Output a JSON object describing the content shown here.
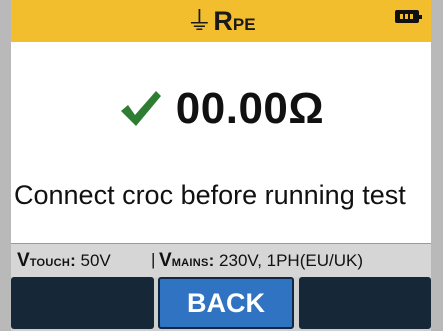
{
  "header": {
    "title_symbol": "⏚",
    "title_main": "R",
    "title_sub": "PE",
    "battery_icon": "battery-full-icon"
  },
  "result": {
    "status_icon": "check-icon",
    "value": "00.00Ω"
  },
  "message": "Connect croc before running test",
  "status_bar": {
    "vtouch_letter": "V",
    "vtouch_sub": "TOUCH",
    "vtouch_value": "50V",
    "separator": "|",
    "vmains_letter": "V",
    "vmains_sub": "MAINS",
    "vmains_value": "230V, 1PH(EU/UK)"
  },
  "softkeys": {
    "left_label": "",
    "center_label": "BACK",
    "right_label": ""
  },
  "colors": {
    "header_bg": "#f3be2e",
    "check": "#2f7d32",
    "button_active": "#2f73c2",
    "button_inactive": "#162738"
  }
}
